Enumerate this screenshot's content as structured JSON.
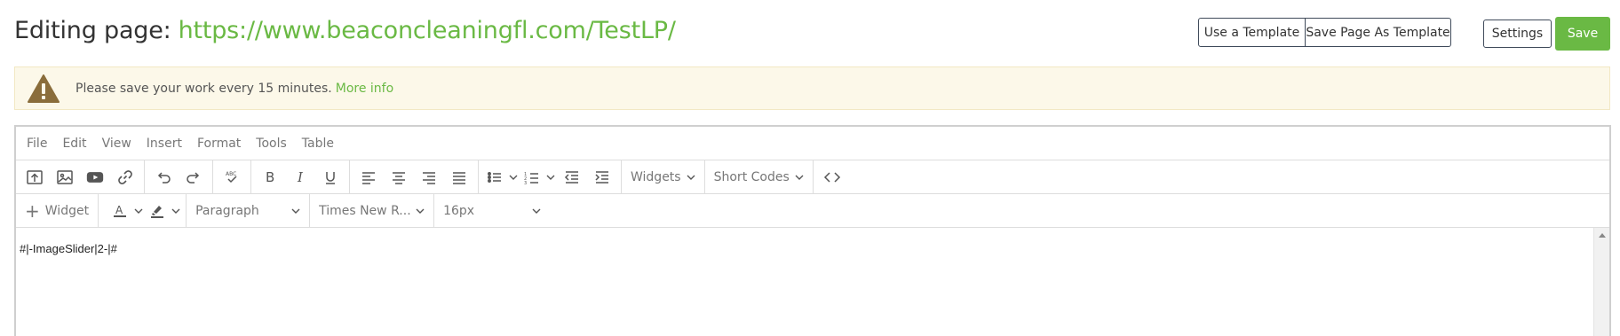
{
  "header": {
    "title_prefix": "Editing page:",
    "url": "https://www.beaconcleaningfl.com/TestLP/"
  },
  "actions": {
    "use_template": "Use a Template",
    "save_as_template": "Save Page As Template",
    "settings": "Settings",
    "save": "Save"
  },
  "alert": {
    "message": "Please save your work every 15 minutes.",
    "link": "More info"
  },
  "menubar": [
    "File",
    "Edit",
    "View",
    "Insert",
    "Format",
    "Tools",
    "Table"
  ],
  "toolbar": {
    "widgets_label": "Widgets",
    "shortcodes_label": "Short Codes"
  },
  "toolbar2": {
    "widget_label": "Widget",
    "block_format": "Paragraph",
    "font_family": "Times New R...",
    "font_size": "16px"
  },
  "editor": {
    "content": "#|-ImageSlider|2-|#"
  },
  "colors": {
    "accent": "#6ab944",
    "alert_bg": "#fcf8e9",
    "warning_icon": "#8a6d3b"
  }
}
